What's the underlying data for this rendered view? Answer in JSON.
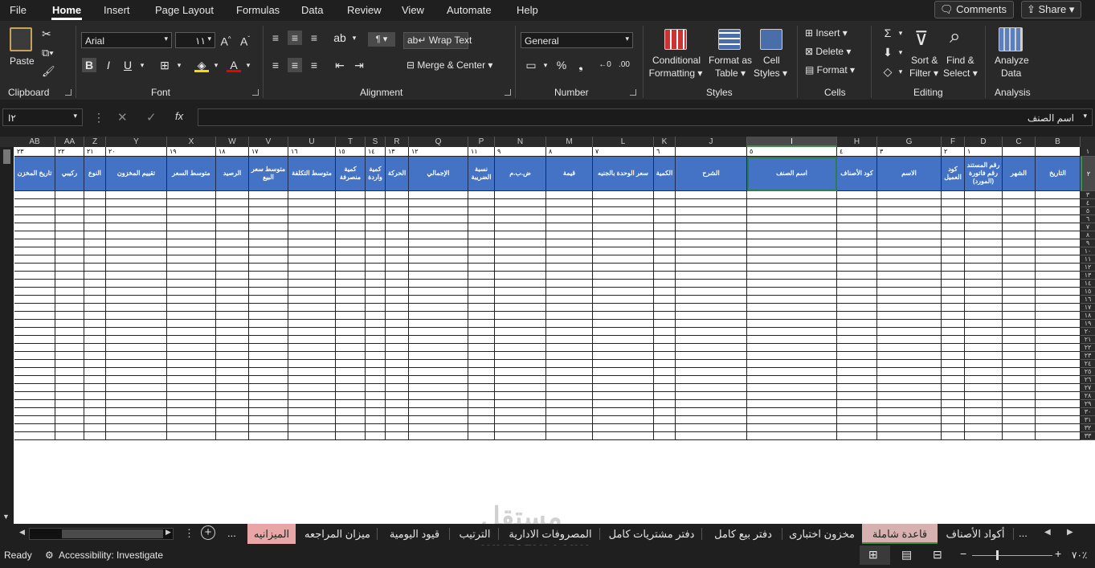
{
  "menu": {
    "items": [
      "File",
      "Home",
      "Insert",
      "Page Layout",
      "Formulas",
      "Data",
      "Review",
      "View",
      "Automate",
      "Help"
    ],
    "comments": "Comments",
    "share": "Share"
  },
  "ribbon": {
    "groups": {
      "clipboard": "Clipboard",
      "font": "Font",
      "alignment": "Alignment",
      "number": "Number",
      "styles": "Styles",
      "cells": "Cells",
      "editing": "Editing",
      "analysis": "Analysis"
    },
    "paste": "Paste",
    "font_name": "Arial",
    "font_size": "١١",
    "wrap_text": "Wrap Text",
    "merge_center": "Merge & Center",
    "number_format": "General",
    "conditional_formatting": [
      "Conditional",
      "Formatting"
    ],
    "format_as_table": [
      "Format as",
      "Table"
    ],
    "cell_styles": [
      "Cell",
      "Styles"
    ],
    "insert": "Insert",
    "delete": "Delete",
    "format": "Format",
    "sort_filter": [
      "Sort &",
      "Filter"
    ],
    "find_select": [
      "Find &",
      "Select"
    ],
    "analyze_data": [
      "Analyze",
      "Data"
    ]
  },
  "formula_bar": {
    "name_box": "I٢",
    "fx": "fx",
    "content": "اسم الصنف"
  },
  "columns": [
    "AB",
    "AA",
    "Z",
    "Y",
    "X",
    "W",
    "V",
    "U",
    "T",
    "S",
    "R",
    "Q",
    "P",
    "N",
    "M",
    "L",
    "K",
    "J",
    "I",
    "H",
    "G",
    "F",
    "D",
    "C",
    "B"
  ],
  "row1_numbers": [
    "٢٣",
    "٢٢",
    "٢١",
    "٢٠",
    "١٩",
    "١٨",
    "١٧",
    "١٦",
    "١٥",
    "١٤",
    "١٣",
    "١٢",
    "١١",
    "٩",
    "٨",
    "٧",
    "٦",
    "",
    "٥",
    "٤",
    "٣",
    "٢",
    "١",
    "",
    ""
  ],
  "headers": [
    "تاريخ المخزن",
    "ركيبي",
    "النوع",
    "تقييم المخزون",
    "متوسط السعر",
    "الرصيد",
    "متوسط سعر البيع",
    "متوسط التكلفة",
    "كمية منصرفة",
    "كمية واردة",
    "الحركة",
    "الإجمالي",
    "نسبة الضريبة",
    "ض.ب.م",
    "قيمة",
    "سعر الوحدة بالجنيه",
    "الكمية",
    "الشرح",
    "اسم الصنف",
    "كود الأصناف",
    "الاسم",
    "كود العميل",
    "رقم المستند رقم فاتورة (المورد)",
    "الشهر",
    "التاريخ"
  ],
  "row_numbers": [
    "١",
    "٢",
    "٣",
    "٤",
    "٥",
    "٦",
    "٧",
    "٨",
    "٩",
    "١٠",
    "١١",
    "١٢",
    "١٣",
    "١٤",
    "١٥",
    "١٦",
    "١٧",
    "١٨",
    "١٩",
    "٢٠",
    "٢١",
    "٢٢",
    "٢٣",
    "٢٤",
    "٢٥",
    "٢٦",
    "٢٧",
    "٢٨",
    "٢٩",
    "٣٠",
    "٣١",
    "٣٢",
    "٣٣"
  ],
  "sheet_tabs": [
    "الميزانيه",
    "ميزان المراجعه",
    "قيود اليومية",
    "الترتيب",
    "المصروفات الادارية",
    "دفتر مشتريات كامل",
    "دفتر بيع كامل",
    "مخزون اختبارى",
    "قاعدة شاملة",
    "أكواد الأصناف"
  ],
  "tab_more": "...",
  "status": {
    "ready": "Ready",
    "accessibility": "Accessibility: Investigate",
    "zoom": "٧٠٪"
  },
  "watermark": {
    "text": "مستقل",
    "site": "mostaql.com"
  },
  "colors": {
    "header_blue": "#4472c4",
    "selection_green": "#2e7d4f",
    "tab_pink": "#e9a6a6"
  }
}
